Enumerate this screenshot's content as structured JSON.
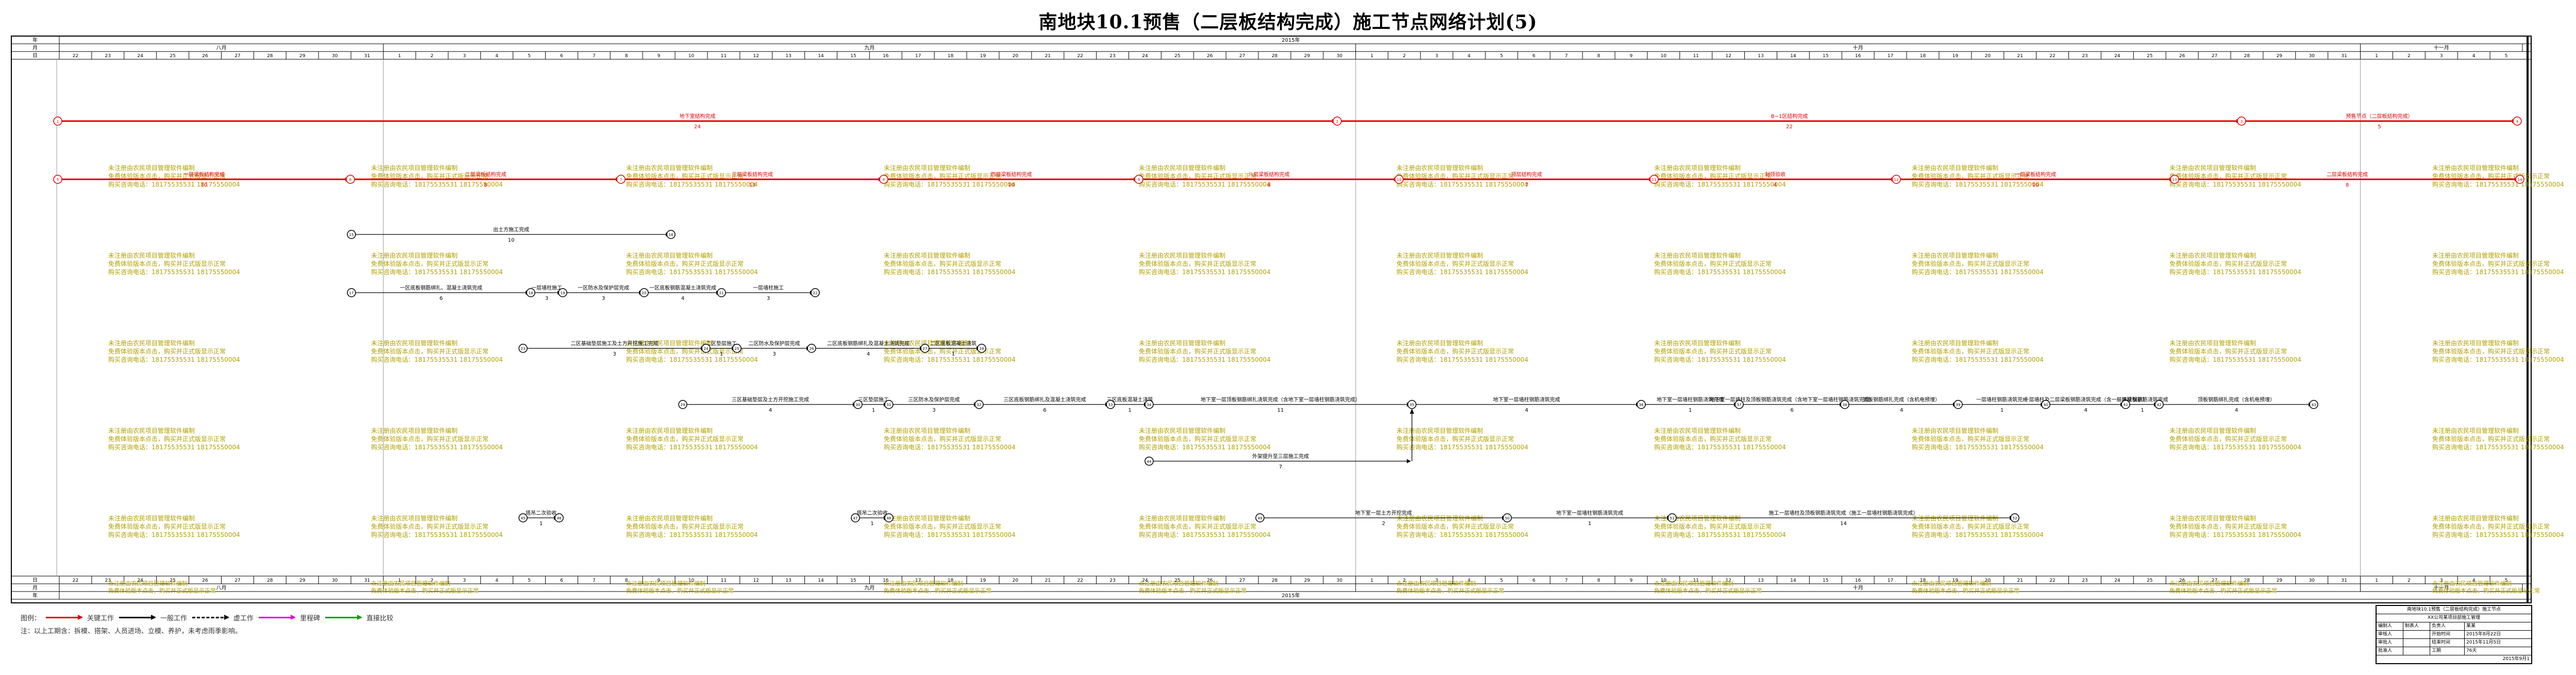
{
  "title": "南地块10.1预售（二层板结构完成）施工节点网络计划(5)",
  "timeline": {
    "row_labels": [
      "年",
      "月",
      "日"
    ],
    "year": "2015年",
    "months": [
      "八月",
      "九月",
      "十月",
      "十一月"
    ],
    "days_aug": [
      "22",
      "23",
      "24",
      "25",
      "26",
      "27",
      "28",
      "29",
      "30",
      "31"
    ],
    "days_sep": [
      "1",
      "2",
      "3",
      "4",
      "5",
      "6",
      "7",
      "8",
      "9",
      "10",
      "11",
      "12",
      "13",
      "14",
      "15",
      "16",
      "17",
      "18",
      "19",
      "20",
      "21",
      "22",
      "23",
      "24",
      "25",
      "26",
      "27",
      "28",
      "29",
      "30"
    ],
    "days_oct": [
      "1",
      "2",
      "3",
      "4",
      "5",
      "6",
      "7",
      "8",
      "9",
      "10",
      "11",
      "12",
      "13",
      "14",
      "15",
      "16",
      "17",
      "18",
      "19",
      "20",
      "21",
      "22",
      "23",
      "24",
      "25",
      "26",
      "27",
      "28",
      "29",
      "30",
      "31"
    ],
    "days_nov": [
      "1",
      "2",
      "3",
      "4",
      "5"
    ]
  },
  "watermark": {
    "line1": "未注册由农民项目管理软件编制",
    "line2": "免费体验版本点击，购买并正式版显示正常",
    "line3": "购买咨询电话：18175535531 18175550004"
  },
  "activities": [
    {
      "label": "地下室结构完成",
      "dur": "24"
    },
    {
      "label": "B~1区结构完成",
      "dur": "22"
    },
    {
      "label": "预售节点（二层板结构完成）",
      "dur": "5"
    },
    {
      "label": "一层梁板结构完成",
      "dur": "10"
    },
    {
      "label": "二层梁板结构完成",
      "dur": "8"
    },
    {
      "label": "三层梁板结构完成",
      "dur": "13"
    },
    {
      "label": "四层梁板结构完成",
      "dur": "10"
    },
    {
      "label": "八层梁板结构完成",
      "dur": "8"
    },
    {
      "label": "顶层结构完成",
      "dur": "7"
    },
    {
      "label": "封顶验收",
      "dur": "4"
    },
    {
      "label": "出土方施工完成",
      "dur": "10"
    },
    {
      "label": "一区底板钢筋绑扎、混凝土浇筑完成",
      "dur": "6"
    },
    {
      "label": "一层墙柱施工",
      "dur": "3"
    },
    {
      "label": "一区防水及保护层完成",
      "dur": "3"
    },
    {
      "label": "一区底板钢筋混凝土浇筑完成",
      "dur": "4"
    },
    {
      "label": "二区挡土墙施工",
      "dur": "1"
    },
    {
      "label": "二区基础垫层施工及土方开挖施工完成",
      "dur": "3"
    },
    {
      "label": "二区垫层施工",
      "dur": "1"
    },
    {
      "label": "二区防水及保护层完成",
      "dur": "3"
    },
    {
      "label": "二区底板钢筋绑扎及混凝土浇筑完成",
      "dur": "4"
    },
    {
      "label": "二区底板混凝土浇筑",
      "dur": "1"
    },
    {
      "label": "三区基础垫层及土方开挖施工完成",
      "dur": "4"
    },
    {
      "label": "三区垫层施工",
      "dur": "1"
    },
    {
      "label": "三区防水及保护层完成",
      "dur": "3"
    },
    {
      "label": "三区底板钢筋绑扎及混凝土浇筑完成",
      "dur": "6"
    },
    {
      "label": "三区底板混凝土浇筑",
      "dur": "1"
    },
    {
      "label": "地下室一层顶板钢筋绑扎浇筑完成（含地下室一层墙柱钢筋浇筑完成）",
      "dur": "11"
    },
    {
      "label": "地下室一层墙柱钢筋浇筑完成",
      "dur": "4"
    },
    {
      "label": "地下室一层墙柱钢筋浇筑完成",
      "dur": "1"
    },
    {
      "label": "地下室一层墙柱及顶板钢筋浇筑完成（含地下室一层墙柱钢筋浇筑完成）",
      "dur": "6"
    },
    {
      "label": "顶板钢筋绑扎完成（含机电预埋）",
      "dur": "4"
    },
    {
      "label": "一层墙柱钢筋浇筑完成",
      "dur": "1"
    },
    {
      "label": "一层墙柱及二层梁板钢筋浇筑完成（含一层墙柱钢筋）",
      "dur": "4"
    },
    {
      "label": "一层梁板钢筋浇筑完成",
      "dur": "1"
    },
    {
      "label": "外架提升至三层施工完成",
      "dur": "7"
    },
    {
      "label": "地下室一层土方开挖完成",
      "dur": "2"
    },
    {
      "label": "地下室一层墙柱钢筋浇筑完成",
      "dur": "1"
    },
    {
      "label": "施工一层墙柱钢筋浇筑完成",
      "dur": "4"
    },
    {
      "label": "施工一层墙柱及顶板钢筋浇筑完成（施工一层墙柱钢筋浇筑完成）",
      "dur": "14"
    },
    {
      "label": "塔吊二次验收",
      "dur": "1"
    },
    {
      "label": "塔吊二次验收",
      "dur": "1"
    }
  ],
  "node_numbers": [
    "1",
    "2",
    "3",
    "4",
    "5",
    "6",
    "7",
    "8",
    "9",
    "10",
    "11",
    "12",
    "13",
    "14",
    "15",
    "16",
    "17",
    "18",
    "19",
    "20",
    "21",
    "22",
    "23",
    "24",
    "25",
    "26",
    "27",
    "28",
    "29",
    "30",
    "31",
    "32",
    "33",
    "34",
    "35",
    "36",
    "37",
    "38",
    "39",
    "40",
    "41",
    "42",
    "43",
    "44",
    "45",
    "46",
    "47",
    "48",
    "49",
    "50",
    "51",
    "52",
    "53",
    "54",
    "55",
    "56",
    "57",
    "58"
  ],
  "legend": {
    "label": "图例：",
    "items": [
      "关键工作",
      "一般工作",
      "虚工作",
      "里程碑",
      "直接比较"
    ],
    "note": "注：以上工期含：拆模、搭架、人员进场、立模、养护，未考虑雨季影响。"
  },
  "title_block": {
    "project": "南地块10.1预售（二层板结构完成）施工节点",
    "subtitle": "XX公司某项目部施工管理",
    "rows": [
      [
        "编制人",
        "制表人",
        "负责人",
        "某某"
      ],
      [
        "审核人",
        "",
        "开始时间",
        "2015年8月22日"
      ],
      [
        "审批人",
        "",
        "结束时间",
        "2015年11月5日"
      ],
      [
        "批准人",
        "",
        "工期",
        "76天"
      ]
    ],
    "date": "2015年9月1"
  },
  "colors": {
    "critical": "#e00000",
    "normal": "#000000",
    "grid": "#999999",
    "watermark": "#b0a000"
  }
}
